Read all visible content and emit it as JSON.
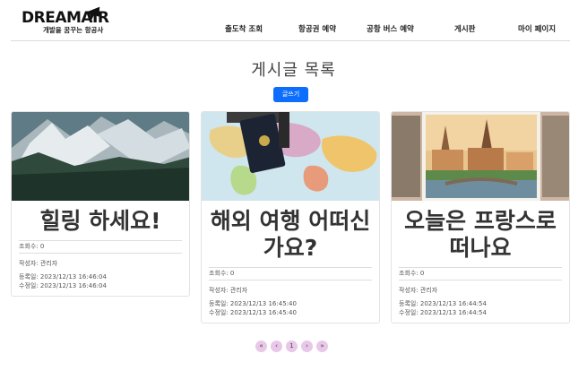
{
  "logo": {
    "main": "DREAMAIR",
    "sub": "개발을 꿈꾸는 항공사"
  },
  "nav": [
    {
      "label": "출도착 조회"
    },
    {
      "label": "항공권 예약"
    },
    {
      "label": "공항 버스 예약"
    },
    {
      "label": "게시판"
    },
    {
      "label": "마이 페이지"
    }
  ],
  "page": {
    "title": "게시글 목록",
    "write_button": "글쓰기"
  },
  "posts": [
    {
      "title": "힐링 하세요!",
      "views": "조회수: 0",
      "author": "작성자: 관리자",
      "created": "등록일: 2023/12/13 16:46:04",
      "modified": "수정일: 2023/12/13 16:46:04",
      "image": "mountain-forest-photo"
    },
    {
      "title": "해외 여행 어떠신가요?",
      "views": "조회수: 0",
      "author": "작성자: 관리자",
      "created": "등록일: 2023/12/13 16:45:40",
      "modified": "수정일: 2023/12/13 16:45:40",
      "image": "world-map-passport-photo"
    },
    {
      "title": "오늘은 프랑스로 떠나요",
      "views": "조회수: 0",
      "author": "작성자: 관리자",
      "created": "등록일: 2023/12/13 16:44:54",
      "modified": "수정일: 2023/12/13 16:44:54",
      "image": "france-town-photo"
    }
  ],
  "pagination": {
    "first": "«",
    "prev": "‹",
    "current": "1",
    "next": "›",
    "last": "»"
  },
  "colors": {
    "primary": "#0d6efd",
    "pagination_bg": "#e8c7e9"
  }
}
